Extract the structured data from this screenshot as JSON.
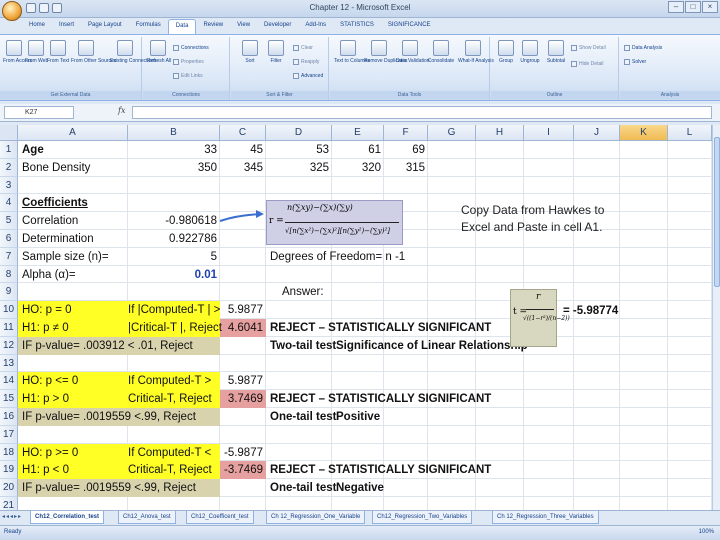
{
  "window": {
    "title": "Chapter 12 - Microsoft Excel"
  },
  "ribbon": {
    "tabs": [
      "Home",
      "Insert",
      "Page Layout",
      "Formulas",
      "Data",
      "Review",
      "View",
      "Developer",
      "Add-Ins",
      "STATISTICS",
      "SIGNIFICANCE"
    ],
    "active_tab": "Data",
    "groups": [
      "Get External Data",
      "Connections",
      "Sort & Filter",
      "Data Tools",
      "Outline",
      "Analysis"
    ],
    "buttons": {
      "from_access": "From Access",
      "from_web": "From Web",
      "from_text": "From Text",
      "from_other": "From Other Sources",
      "existing": "Existing Connections",
      "refresh": "Refresh All",
      "connections": "Connections",
      "properties": "Properties",
      "edit_links": "Edit Links",
      "sort": "Sort",
      "filter": "Filter",
      "clear": "Clear",
      "reapply": "Reapply",
      "advanced": "Advanced",
      "text_to_columns": "Text to Columns",
      "remove_duplicates": "Remove Duplicates",
      "data_validation": "Data Validation",
      "consolidate": "Consolidate",
      "what_if": "What-If Analysis",
      "group": "Group",
      "ungroup": "Ungroup",
      "subtotal": "Subtotal",
      "show_detail": "Show Detail",
      "hide_detail": "Hide Detail",
      "data_analysis": "Data Analysis",
      "solver": "Solver"
    }
  },
  "formula_bar": {
    "name_box": "K27",
    "fx": "fx",
    "value": ""
  },
  "columns": [
    "A",
    "B",
    "C",
    "D",
    "E",
    "F",
    "G",
    "H",
    "I",
    "J",
    "K",
    "L"
  ],
  "rows": [
    "1",
    "2",
    "3",
    "4",
    "5",
    "6",
    "7",
    "8",
    "9",
    "10",
    "11",
    "12",
    "13",
    "14",
    "15",
    "16",
    "17",
    "18",
    "19",
    "20",
    "21"
  ],
  "cells": {
    "a1": "Age",
    "b1": "33",
    "c1": "45",
    "d1": "53",
    "e1": "61",
    "f1": "69",
    "a2": "Bone Density",
    "b2": "350",
    "c2": "345",
    "d2": "325",
    "e2": "320",
    "f2": "315",
    "a4": "Coefficients",
    "a5": "Correlation",
    "b5": "-0.980618",
    "a6": "Determination",
    "b6": "0.922786",
    "a7": "Sample size (n)=",
    "b7": "5",
    "d7": "Degrees of Freedom= n -1",
    "a8": "Alpha (α)=",
    "b8": "0.01",
    "d9": "Answer:",
    "a10": "HO: p = 0",
    "b10": "If |Computed-T | >",
    "c10": "5.9877",
    "a11": "H1: p ≠ 0",
    "b11": "|Critical-T |, Reject",
    "c11": "4.6041",
    "d11": "REJECT – STATISTICALLY SIGNIFICANT",
    "a12": "IF p-value= .003912 < .01, Reject",
    "d12": "Two-tail test",
    "e12": "Significance of Linear Relationship",
    "a14": "HO: p <= 0",
    "b14": "If Computed-T >",
    "c14": "5.9877",
    "a15": "H1: p > 0",
    "b15": "Critical-T, Reject",
    "c15": "3.7469",
    "d15": "REJECT – STATISTICALLY SIGNIFICANT",
    "a16": "IF p-value= .0019559 <.99, Reject",
    "d16": "One-tail test",
    "e16": "Positive",
    "a18": "HO: p >= 0",
    "b18": "If Computed-T <",
    "c18": "-5.9877",
    "a19": "H1: p < 0",
    "b19": "Critical-T, Reject",
    "c19": "-3.7469",
    "d19": "REJECT – STATISTICALLY SIGNIFICANT",
    "a20": "IF p-value= .0019559 <.99, Reject",
    "d20": "One-tail test",
    "e20": "Negative",
    "t_result": "= -5.98774"
  },
  "note": {
    "line1": "Copy Data from Hawkes to",
    "line2": "Excel and Paste in cell A1."
  },
  "formula_r": {
    "lhs": "r =",
    "numerator": "n(∑xy)−(∑x)(∑y)",
    "denominator": "√[n(∑x²)−(∑x)²][n(∑y²)−(∑y)²]"
  },
  "formula_t": {
    "lhs": "t =",
    "numerator": "r",
    "denominator": "√((1−r²)/(n−2))"
  },
  "sheet_tabs": [
    "Ch12_Correlation_test",
    "Ch12_Anova_test",
    "Ch12_Coefficent_test",
    "Ch 12_Regression_One_Variable",
    "Ch12_Regression_Two_Variables",
    "Ch 12_Regression_Three_Variables"
  ],
  "status": {
    "ready": "Ready",
    "zoom": "100%"
  }
}
